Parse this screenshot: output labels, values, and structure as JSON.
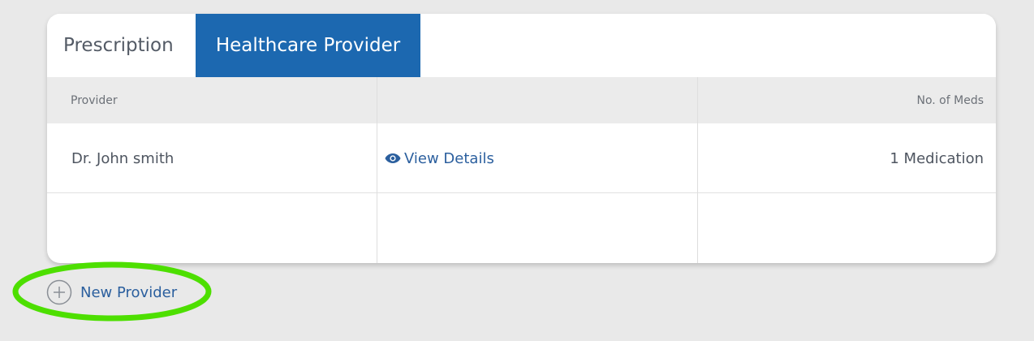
{
  "tabs": [
    {
      "label": "Prescription",
      "active": false
    },
    {
      "label": "Healthcare Provider",
      "active": true
    }
  ],
  "table": {
    "headers": {
      "provider": "Provider",
      "action": "",
      "meds": "No. of Meds"
    },
    "rows": [
      {
        "provider": "Dr. John smith",
        "action": "View Details",
        "meds": "1 Medication"
      }
    ]
  },
  "new_provider": {
    "label": "New Provider",
    "icon": "plus-circle-icon"
  },
  "colors": {
    "active_tab": "#1c68b0",
    "link": "#2b5f9e",
    "highlight": "#4ddf00"
  },
  "icons": {
    "view": "eye-icon"
  }
}
